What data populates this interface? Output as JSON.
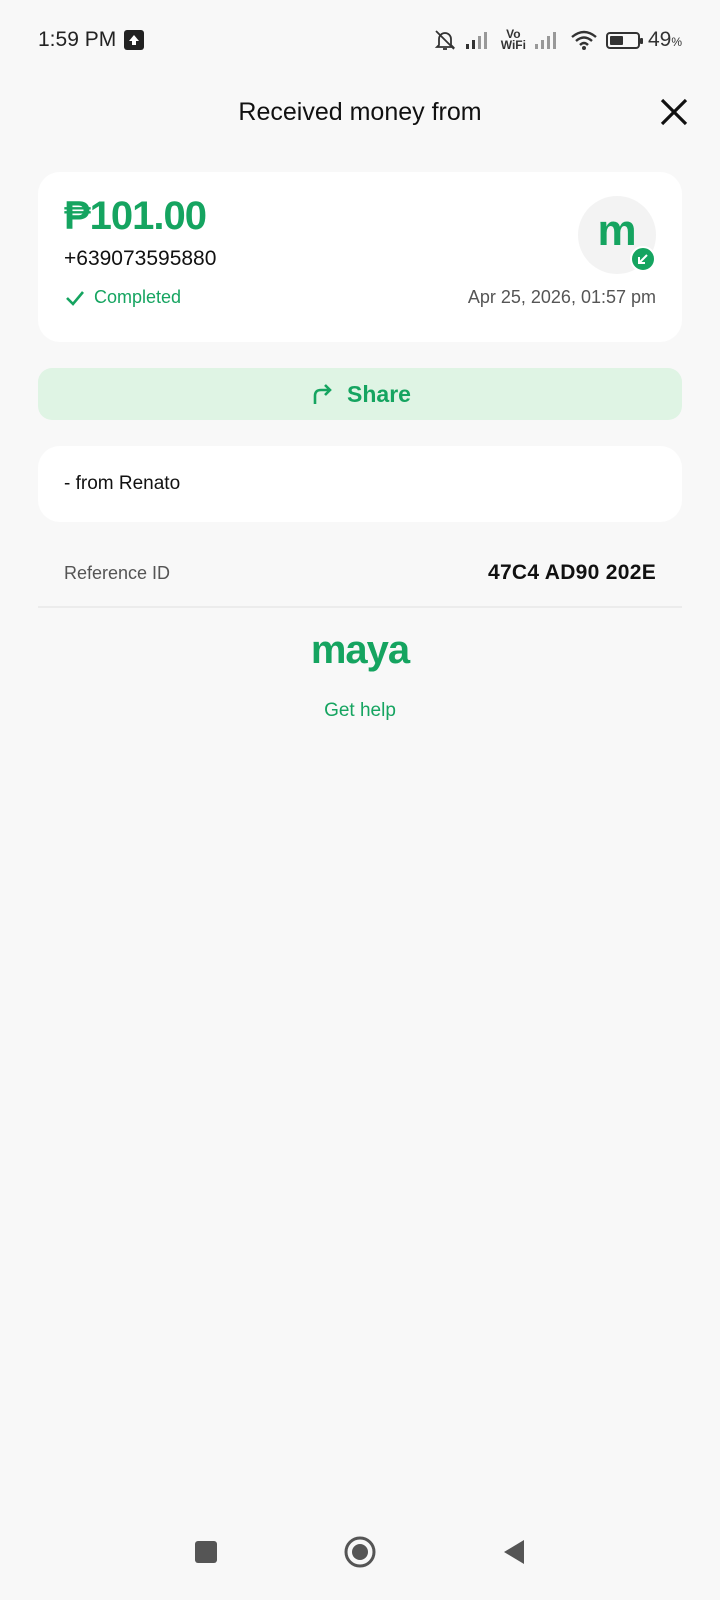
{
  "status_bar": {
    "time": "1:59 PM",
    "vowifi_top": "Vo",
    "vowifi_bottom": "WiFi",
    "battery_percent": "49",
    "battery_unit": "%",
    "battery_level": 0.49
  },
  "header": {
    "title": "Received money from"
  },
  "transaction": {
    "amount": "₱101.00",
    "phone": "+639073595880",
    "status": "Completed",
    "datetime": "Apr 25, 2026, 01:57 pm",
    "avatar_letter": "m"
  },
  "share": {
    "label": "Share"
  },
  "message": {
    "text": "- from Renato"
  },
  "reference": {
    "label": "Reference ID",
    "value": "47C4 AD90 202E"
  },
  "brand": {
    "name": "maya",
    "help_link": "Get help"
  },
  "colors": {
    "accent": "#15a460",
    "share_bg": "#dff4e4",
    "page_bg": "#f8f8f8"
  },
  "icons": {
    "close": "close-icon",
    "share": "share-arrow-icon",
    "check": "check-icon",
    "received": "arrow-down-left-icon"
  }
}
